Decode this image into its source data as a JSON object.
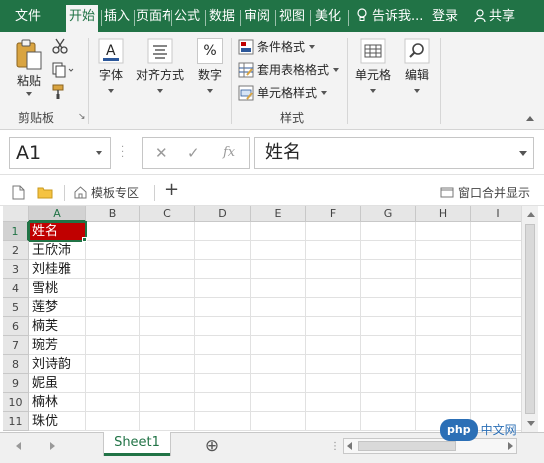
{
  "tabs": [
    {
      "label": "文件",
      "active": false
    },
    {
      "label": "开始",
      "active": true
    },
    {
      "label": "插入",
      "active": false
    },
    {
      "label": "页面布",
      "active": false
    },
    {
      "label": "公式",
      "active": false
    },
    {
      "label": "数据",
      "active": false
    },
    {
      "label": "审阅",
      "active": false
    },
    {
      "label": "视图",
      "active": false
    },
    {
      "label": "美化",
      "active": false
    }
  ],
  "tell_me": "告诉我...",
  "login": "登录",
  "share": "共享",
  "ribbon": {
    "paste_label": "粘贴",
    "clipboard_group": "剪贴板",
    "font_label": "字体",
    "align_label": "对齐方式",
    "number_label": "数字",
    "conditional_format": "条件格式",
    "table_format": "套用表格格式",
    "cell_styles": "单元格样式",
    "styles_group": "样式",
    "cells_label": "单元格",
    "editing_label": "编辑",
    "number_symbol": "%"
  },
  "formula_bar": {
    "name_box": "A1",
    "fx": "fx",
    "content": "姓名"
  },
  "doc_strip": {
    "template_zone": "模板专区",
    "add": "+",
    "window_merge": "窗口合并显示"
  },
  "grid": {
    "columns": [
      "A",
      "B",
      "C",
      "D",
      "E",
      "F",
      "G",
      "H",
      "I"
    ],
    "rows": [
      "1",
      "2",
      "3",
      "4",
      "5",
      "6",
      "7",
      "8",
      "9",
      "10",
      "11"
    ],
    "col_a_values": [
      "姓名",
      "王欣沛",
      "刘桂雅",
      "雪桃",
      "莲梦",
      "楠芙",
      "琬芳",
      "刘诗韵",
      "妮虽",
      "楠林",
      "珠优"
    ],
    "active_cell": "A1",
    "highlight_color": "#c00000"
  },
  "sheets": [
    {
      "name": "Sheet1",
      "active": true
    }
  ],
  "add_sheet": "⊕",
  "colors": {
    "accent": "#217346",
    "ribbon_bg": "#f3f3f3"
  },
  "watermark": {
    "logo": "php",
    "text": "中文网"
  }
}
